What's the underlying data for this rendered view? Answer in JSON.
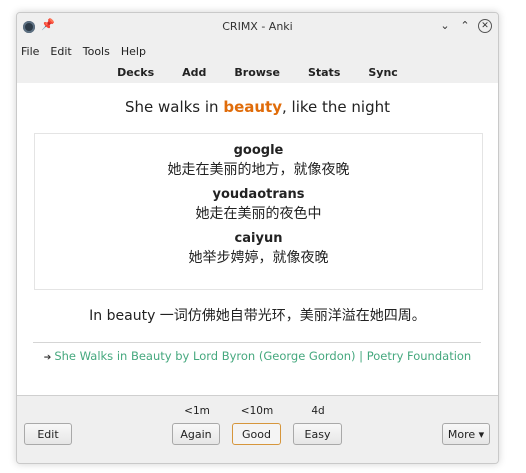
{
  "window": {
    "title": "CRIMX - Anki"
  },
  "menu": [
    "File",
    "Edit",
    "Tools",
    "Help"
  ],
  "toolbar": [
    "Decks",
    "Add",
    "Browse",
    "Stats",
    "Sync"
  ],
  "card": {
    "question_before": "She walks in ",
    "question_highlight": "beauty",
    "question_after": ", like the night",
    "translations": [
      {
        "source": "google",
        "text": "她走在美丽的地方，就像夜晚"
      },
      {
        "source": "youdaotrans",
        "text": "她走在美丽的夜色中"
      },
      {
        "source": "caiyun",
        "text": "她举步娉婷，就像夜晚"
      }
    ],
    "explanation": "In beauty 一词仿佛她自带光环，美丽洋溢在她四周。",
    "source_link": "She Walks in Beauty by Lord Byron (George Gordon) | Poetry Foundation"
  },
  "answer_bar": {
    "edit_label": "Edit",
    "again": {
      "label": "Again",
      "interval": "<1m"
    },
    "good": {
      "label": "Good",
      "interval": "<10m"
    },
    "easy": {
      "label": "Easy",
      "interval": "4d"
    },
    "more_label": "More ▾"
  }
}
